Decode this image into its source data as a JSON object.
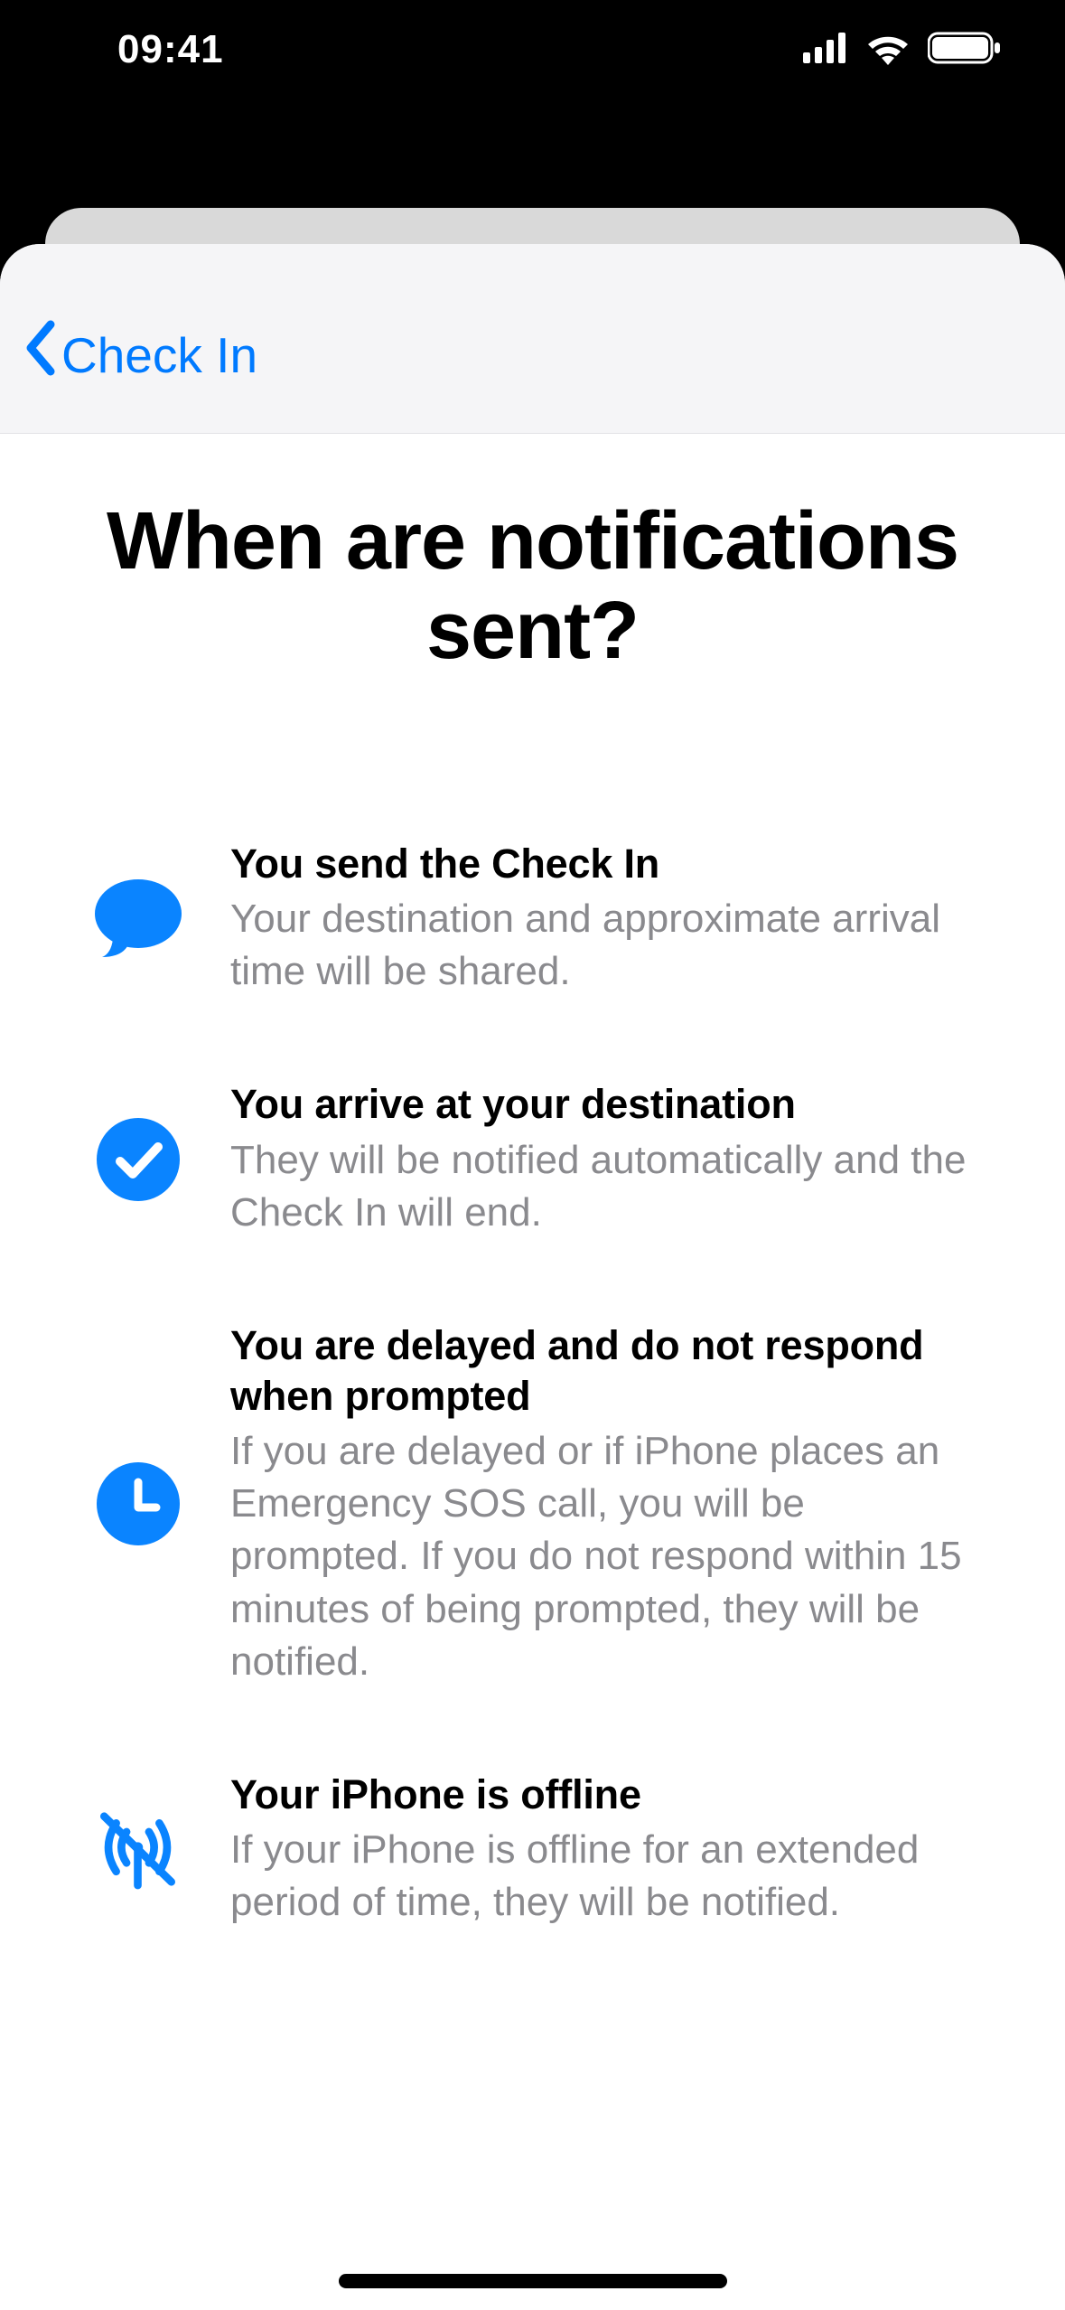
{
  "status": {
    "time": "09:41"
  },
  "nav": {
    "back_label": "Check In"
  },
  "page": {
    "title": "When are notifications sent?"
  },
  "items": [
    {
      "title": "You send the Check In",
      "desc": "Your destination and approximate arrival time will be shared."
    },
    {
      "title": "You arrive at your destination",
      "desc": "They will be notified automatically and the Check In will end."
    },
    {
      "title": "You are delayed and do not respond when prompted",
      "desc": "If you are delayed or if iPhone places an Emergency SOS call, you will be prompted. If you do not respond within 15 minutes of being prompted, they will be notified."
    },
    {
      "title": "Your iPhone is offline",
      "desc": "If your iPhone is offline for an extended period of time, they will be notified."
    }
  ]
}
